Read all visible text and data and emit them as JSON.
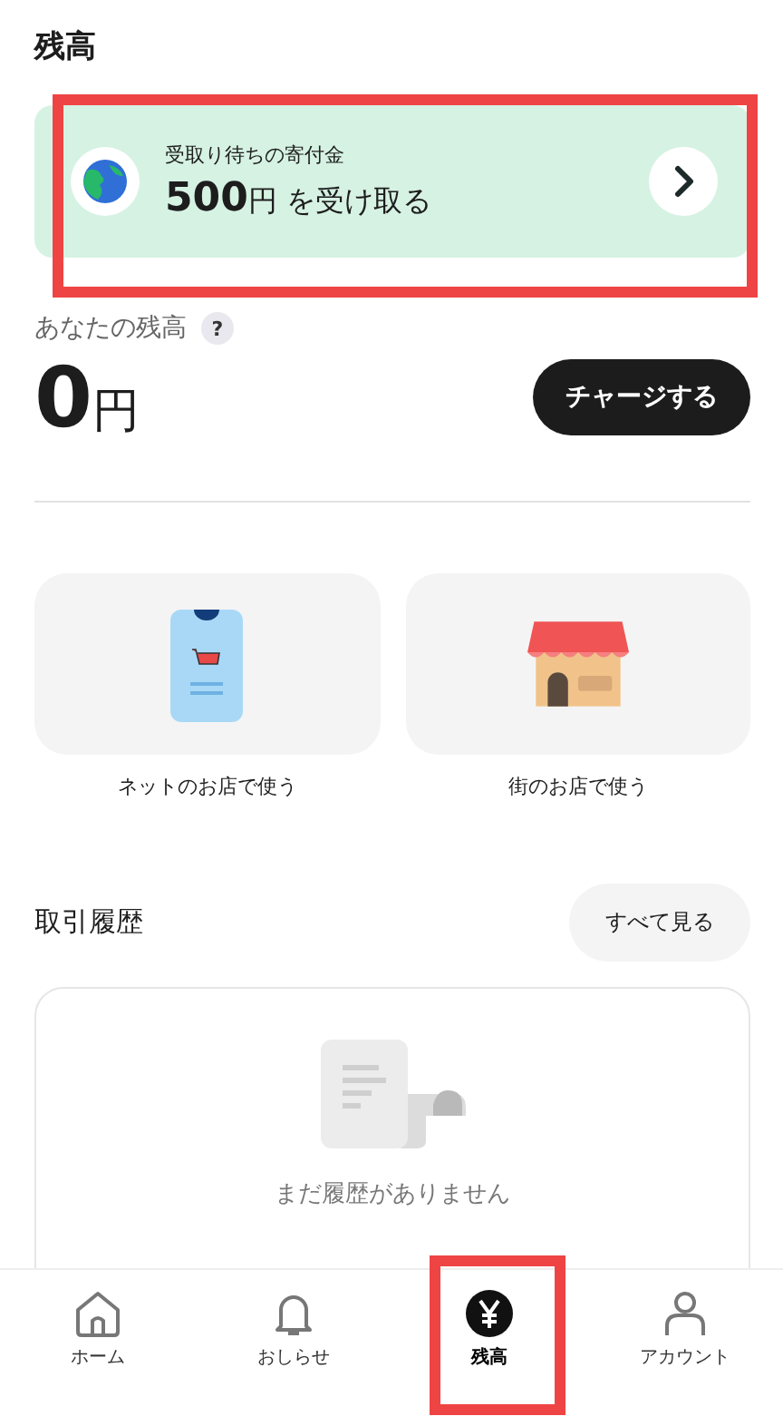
{
  "header": {
    "title": "残高"
  },
  "donation_banner": {
    "caption": "受取り待ちの寄付金",
    "amount": "500",
    "unit": "円",
    "action": "を受け取る",
    "highlighted": true
  },
  "balance": {
    "label": "あなたの残高",
    "help": "?",
    "amount": "0",
    "unit": "円",
    "charge_button": "チャージする"
  },
  "shortcuts": [
    {
      "kind": "online",
      "label": "ネットのお店で使う"
    },
    {
      "kind": "store",
      "label": "街のお店で使う"
    }
  ],
  "history": {
    "title": "取引履歴",
    "see_all": "すべて見る",
    "empty_message": "まだ履歴がありません"
  },
  "bottom_nav": [
    {
      "kind": "home",
      "label": "ホーム",
      "selected": false,
      "highlighted": false
    },
    {
      "kind": "bell",
      "label": "おしらせ",
      "selected": false,
      "highlighted": false
    },
    {
      "kind": "yen",
      "label": "残高",
      "selected": true,
      "highlighted": true
    },
    {
      "kind": "account",
      "label": "アカウント",
      "selected": false,
      "highlighted": false
    }
  ]
}
